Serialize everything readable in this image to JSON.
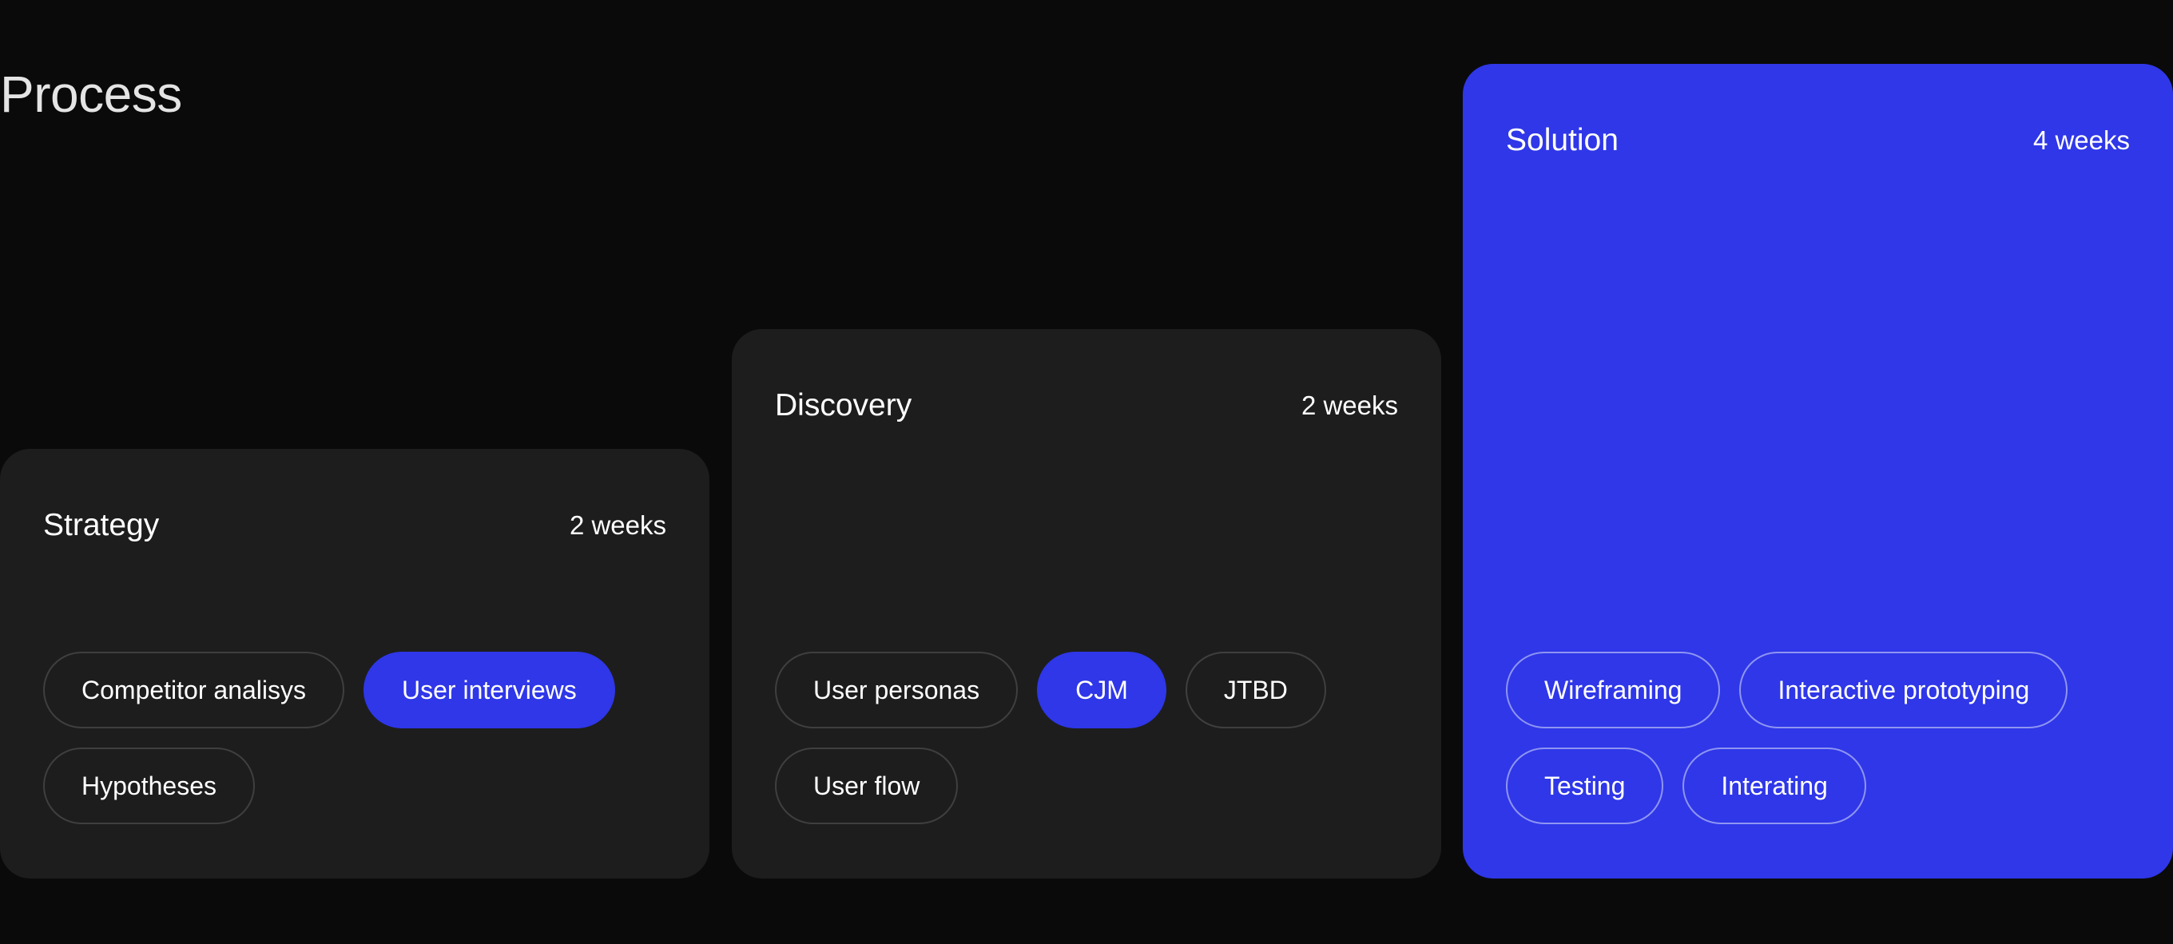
{
  "page": {
    "title": "Process"
  },
  "colors": {
    "background": "#0a0a0a",
    "card": "#1d1d1d",
    "accent": "#2f37e8"
  },
  "stages": [
    {
      "title": "Strategy",
      "duration": "2 weeks",
      "highlighted": false,
      "tags": [
        {
          "label": "Competitor analisys",
          "active": false
        },
        {
          "label": "User interviews",
          "active": true
        },
        {
          "label": "Hypotheses",
          "active": false
        }
      ]
    },
    {
      "title": "Discovery",
      "duration": "2 weeks",
      "highlighted": false,
      "tags": [
        {
          "label": "User personas",
          "active": false
        },
        {
          "label": "CJM",
          "active": true
        },
        {
          "label": "JTBD",
          "active": false
        },
        {
          "label": "User flow",
          "active": false
        }
      ]
    },
    {
      "title": "Solution",
      "duration": "4 weeks",
      "highlighted": true,
      "tags": [
        {
          "label": "Wireframing",
          "active": false
        },
        {
          "label": "Interactive prototyping",
          "active": false
        },
        {
          "label": "Testing",
          "active": false
        },
        {
          "label": "Interating",
          "active": false
        }
      ]
    }
  ]
}
